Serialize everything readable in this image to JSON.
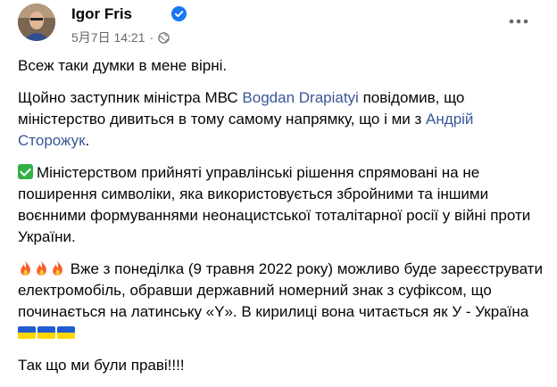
{
  "author": {
    "name": "Igor Fris",
    "verified": true,
    "timestamp": "5月7日 14:21",
    "separator": "·",
    "audience_icon": "globe-icon"
  },
  "menu_icon": "more-options-icon",
  "post": {
    "p1": "Всеж таки думки в мене вірні.",
    "p2": {
      "t1": "Щойно заступник міністра МВС ",
      "link1": "Bogdan Drapiatyi",
      "t2": " повідомив, що міністерство дивиться в тому самому напрямку, що і ми з ",
      "link2": "Андрій Сторожук",
      "t3": "."
    },
    "p3": {
      "emoji": "white-check-mark-icon",
      "text": "Міністерством прийняті управлінські рішення спрямовані на не поширення символіки, яка використовується збройними та іншими воєнними формуваннями неонацистської тоталітарної росії у війні проти України."
    },
    "p4": {
      "emoji": "fire-icon",
      "text": "Вже з понеділка (9 травня 2022 року) можливо буде зареєструвати електромобіль, обравши державний номерний знак з суфіксом, що починається на латинську «Y». В кирилиці вона читається як У - Україна",
      "flags": "ukraine-flag-icon"
    },
    "p5": "Так що ми були праві!!!!"
  },
  "colors": {
    "link": "#385898",
    "meta": "#65676b",
    "verified": "#1877f2"
  }
}
